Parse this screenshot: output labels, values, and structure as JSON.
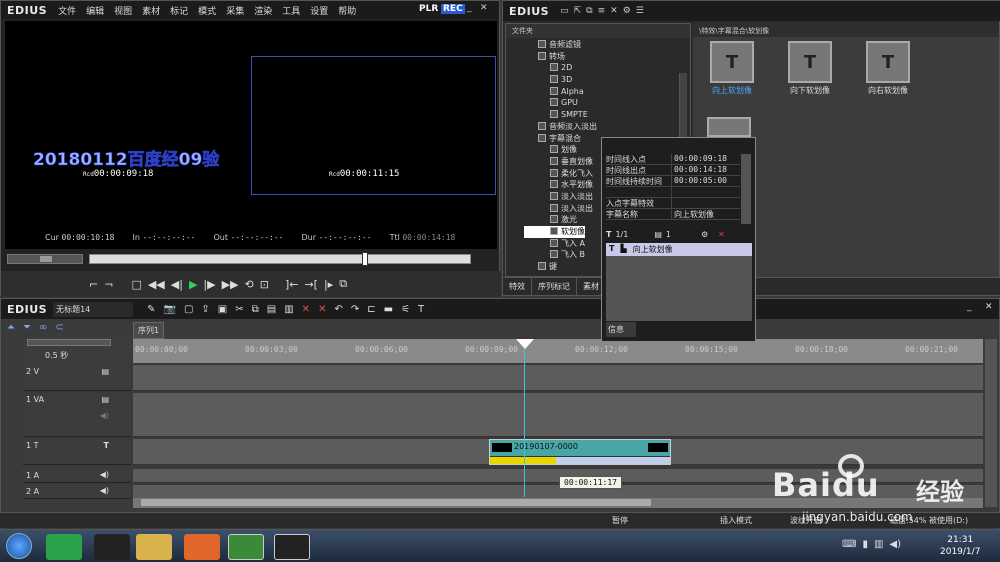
{
  "app": {
    "logo": "EDIUS"
  },
  "menu": [
    "文件",
    "编辑",
    "视图",
    "素材",
    "标记",
    "模式",
    "采集",
    "渲染",
    "工具",
    "设置",
    "帮助"
  ],
  "monitor": {
    "plr": "PLR",
    "rec": "REC",
    "overlay_text": "20180112百度经09验",
    "rcd_left_label": "Rcd",
    "rcd_left": "00:00:09:18",
    "rcd_right_label": "Rcd",
    "rcd_right": "00:00:11:15",
    "tc": [
      {
        "label": "Cur",
        "value": "00:00:10:18"
      },
      {
        "label": "In",
        "value": "--:--:--:--"
      },
      {
        "label": "Out",
        "value": "--:--:--:--"
      },
      {
        "label": "Dur",
        "value": "--:--:--:--"
      },
      {
        "label": "Ttl",
        "value": "00:00:14:18"
      }
    ]
  },
  "effects": {
    "logo": "EDIUS",
    "folder_header": "文件夹",
    "path": "\\特效\\字幕混合\\软划像",
    "tree": [
      {
        "label": "音频滤镜",
        "indent": 1
      },
      {
        "label": "转场",
        "indent": 1
      },
      {
        "label": "2D",
        "indent": 2
      },
      {
        "label": "3D",
        "indent": 2
      },
      {
        "label": "Alpha",
        "indent": 2
      },
      {
        "label": "GPU",
        "indent": 2
      },
      {
        "label": "SMPTE",
        "indent": 2
      },
      {
        "label": "音频淡入淡出",
        "indent": 1
      },
      {
        "label": "字幕混合",
        "indent": 1
      },
      {
        "label": "划像",
        "indent": 2
      },
      {
        "label": "垂直划像",
        "indent": 2
      },
      {
        "label": "柔化飞入",
        "indent": 2
      },
      {
        "label": "水平划像",
        "indent": 2
      },
      {
        "label": "淡入淡出",
        "indent": 2
      },
      {
        "label": "淡入淡出",
        "indent": 2
      },
      {
        "label": "激光",
        "indent": 2
      },
      {
        "label": "软划像",
        "indent": 2
      },
      {
        "label": "飞入 A",
        "indent": 2
      },
      {
        "label": "飞入 B",
        "indent": 2
      },
      {
        "label": "键",
        "indent": 1
      }
    ],
    "thumbs": [
      {
        "label": "向上软划像"
      },
      {
        "label": "向下软划像"
      },
      {
        "label": "向右软划像"
      }
    ],
    "tabs": [
      "特效",
      "序列标记",
      "素材"
    ]
  },
  "info_popup": {
    "rows": [
      {
        "k": "时间线入点",
        "v": "00:00:09:18"
      },
      {
        "k": "时间线出点",
        "v": "00:00:14:18"
      },
      {
        "k": "时间线持续时间",
        "v": "00:00:05:00"
      },
      {
        "k": "",
        "v": ""
      },
      {
        "k": "入点字幕特效",
        "v": ""
      },
      {
        "k": "字幕名称",
        "v": "向上软划像"
      }
    ],
    "page": "1/1",
    "count": "1",
    "selected_item": "向上软划像",
    "footer": "信息"
  },
  "timeline": {
    "logo": "EDIUS",
    "project": "无标题14",
    "sequence_tab": "序列1",
    "scale": "0.5 秒",
    "ruler": [
      "00:00:00;00",
      "00:00:03;00",
      "00:00:06;00",
      "00:00:09;00",
      "00:00:12;00",
      "00:00:15;00",
      "00:00:18;00",
      "00:00:21;00"
    ],
    "tracks": [
      {
        "name": "2 V",
        "type": "V"
      },
      {
        "name": "1 VA",
        "type": "VA"
      },
      {
        "name": "1 T",
        "type": "T"
      },
      {
        "name": "1 A",
        "type": "A"
      },
      {
        "name": "2 A",
        "type": "A"
      }
    ],
    "clip_name": "20190107-0000",
    "tooltip": "00:00:11:17"
  },
  "status": {
    "pause": "暂停",
    "insert_mode": "插入模式",
    "ripple": "波纹开启",
    "disk": "磁盘:54% 被使用(D:)"
  },
  "taskbar": {
    "time": "21:31",
    "date": "2019/1/7"
  },
  "watermark": {
    "brand": "Baidu",
    "sub": "经验",
    "url": "jingyan.baidu.com"
  }
}
